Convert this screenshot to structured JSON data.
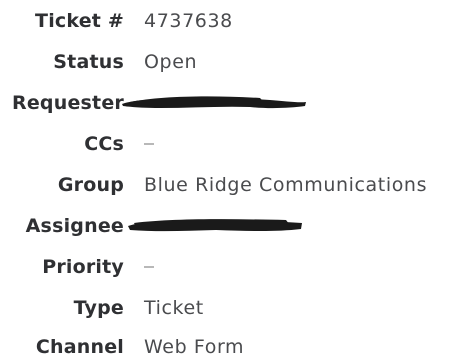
{
  "fields": [
    {
      "label": "Ticket #",
      "value": "4737638",
      "kind": "text"
    },
    {
      "label": "Status",
      "value": "Open",
      "kind": "text"
    },
    {
      "label": "Requester",
      "value": "",
      "kind": "redacted"
    },
    {
      "label": "CCs",
      "value": "",
      "kind": "empty"
    },
    {
      "label": "Group",
      "value": "Blue Ridge Communications",
      "kind": "text"
    },
    {
      "label": "Assignee",
      "value": "",
      "kind": "redacted"
    },
    {
      "label": "Priority",
      "value": "",
      "kind": "empty"
    },
    {
      "label": "Type",
      "value": "Ticket",
      "kind": "text"
    },
    {
      "label": "Channel",
      "value": "Web Form",
      "kind": "text"
    }
  ],
  "colors": {
    "label": "#2f3033",
    "value": "#4a4b4e",
    "empty_dash": "#b8b8b8",
    "redaction": "#1a1a1a"
  }
}
